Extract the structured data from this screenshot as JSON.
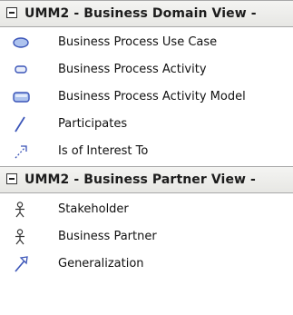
{
  "sections": [
    {
      "title": "UMM2 - Business Domain View -",
      "items": [
        {
          "label": "Business Process Use Case",
          "icon": "ellipse-icon"
        },
        {
          "label": "Business Process Activity",
          "icon": "rounded-rect-icon"
        },
        {
          "label": "Business Process Activity Model",
          "icon": "activity-model-icon"
        },
        {
          "label": "Participates",
          "icon": "association-line-icon"
        },
        {
          "label": "Is of Interest To",
          "icon": "dependency-arrow-icon"
        }
      ]
    },
    {
      "title": "UMM2 - Business Partner View -",
      "items": [
        {
          "label": "Stakeholder",
          "icon": "actor-icon"
        },
        {
          "label": "Business Partner",
          "icon": "actor-icon"
        },
        {
          "label": "Generalization",
          "icon": "generalization-arrow-icon"
        }
      ]
    }
  ],
  "colors": {
    "icon_blue": "#3b55b8",
    "icon_fill": "#aec3ee",
    "header_background": "#ececea"
  }
}
